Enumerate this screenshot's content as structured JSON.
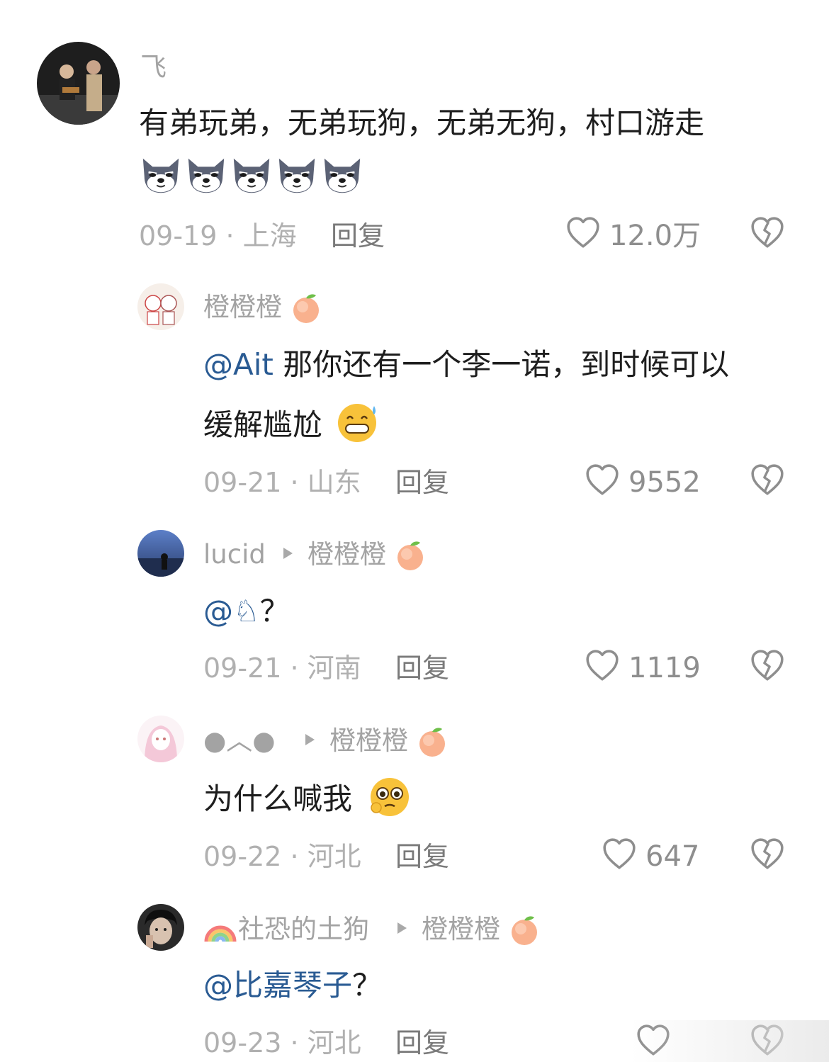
{
  "comments": [
    {
      "user": "飞",
      "text": "有弟玩弟，无弟玩狗，无弟无狗，村口游走",
      "emoji_count": 5,
      "date": "09-19",
      "location": "上海",
      "reply_label": "回复",
      "likes": "12.0万"
    },
    {
      "user": "橙橙橙",
      "mention": "@Ait",
      "text_line1": " 那你还有一个李一诺，到时候可以",
      "text_line2": "缓解尴尬",
      "date": "09-21",
      "location": "山东",
      "reply_label": "回复",
      "likes": "9552"
    },
    {
      "user": "lucid",
      "reply_to": "橙橙橙",
      "mention": "@",
      "text": "？",
      "date": "09-21",
      "location": "河南",
      "reply_label": "回复",
      "likes": "1119"
    },
    {
      "user": "●︿●",
      "reply_to": "橙橙橙",
      "text": "为什么喊我",
      "date": "09-22",
      "location": "河北",
      "reply_label": "回复",
      "likes": "647"
    },
    {
      "user": "社恐的土狗",
      "reply_to": "橙橙橙",
      "mention": "@比嘉琴子",
      "text": "？",
      "date": "09-23",
      "location": "河北",
      "reply_label": "回复",
      "likes": ""
    }
  ],
  "separator": " · ",
  "colors": {
    "mention": "#2a5b93",
    "username": "#a3a3a3",
    "meta": "#b0b0b0"
  },
  "icons": [
    "heart-outline-icon",
    "broken-heart-icon",
    "reply-arrow-icon",
    "peach-icon"
  ]
}
